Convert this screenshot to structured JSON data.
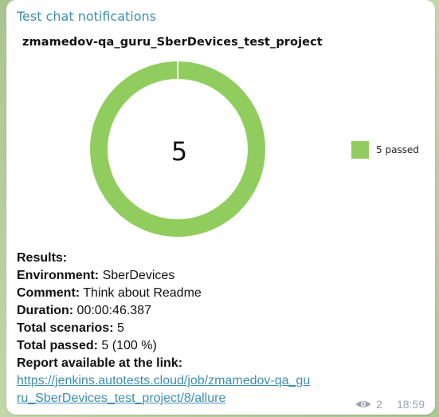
{
  "message": {
    "sender": "Test chat notifications",
    "views": "2",
    "time": "18:59",
    "lines": {
      "results_label": "Results:",
      "environment_label": "Environment:",
      "environment_value": " SberDevices",
      "comment_label": "Comment:",
      "comment_value": " Think about Readme",
      "duration_label": "Duration:",
      "duration_value": " 00:00:46.387",
      "total_scenarios_label": "Total scenarios:",
      "total_scenarios_value": " 5",
      "total_passed_label": "Total passed:",
      "total_passed_value": " 5 (100 %)",
      "report_label": "Report available at the link:",
      "report_link": "https://jenkins.autotests.cloud/job/zmamedov-qa_guru_SberDevices_test_project/8/allure"
    }
  },
  "chart_data": {
    "type": "pie",
    "title": "zmamedov-qa_guru_SberDevices_test_project",
    "center_label": "5",
    "slices": [
      {
        "label": "5 passed",
        "value": 5,
        "color": "#90cd5e"
      }
    ],
    "legend_position": "right"
  },
  "icons": {
    "views": "eye-icon"
  },
  "colors": {
    "accent": "#3a8fb0",
    "passed": "#90cd5e",
    "meta": "#9aa4ad"
  }
}
